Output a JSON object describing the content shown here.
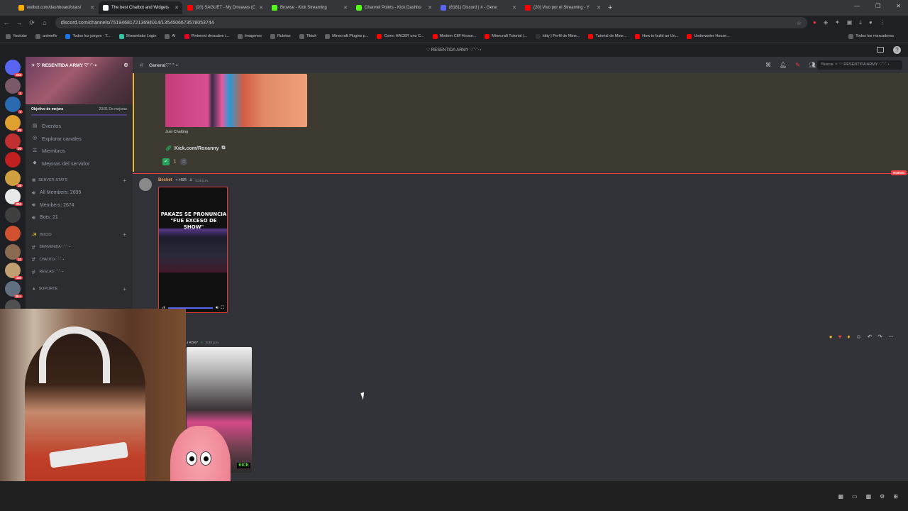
{
  "browser": {
    "tabs": [
      {
        "label": "ixelbot.com/dashboard/stats/",
        "color": "#f9ab00",
        "active": false
      },
      {
        "label": "The best Chatbot and Widgets",
        "color": "#ffffff",
        "active": true
      },
      {
        "label": "(20) SAGUET - My Drreaves (C",
        "color": "#ff0000",
        "active": false
      },
      {
        "label": "Browse - Kick Streaming",
        "color": "#53fc18",
        "active": false
      },
      {
        "label": "Channel Points - Kick Dashbo",
        "color": "#53fc18",
        "active": false
      },
      {
        "label": "(6181) Discord | # - Gene",
        "color": "#5865f2",
        "active": false
      },
      {
        "label": "(20) Vivo por el Streaming - Y",
        "color": "#ff0000",
        "active": false
      }
    ],
    "new_tab": "+",
    "url": "discord.com/channels/751946817213694014/1354506673578053744",
    "bookmarks": [
      {
        "label": "Youtube",
        "color": "#5f6368"
      },
      {
        "label": "animeflv",
        "color": "#5f6368"
      },
      {
        "label": "Todos los juegos - T...",
        "color": "#1a73e8"
      },
      {
        "label": "Streamlabs Login",
        "color": "#31c3a2"
      },
      {
        "label": "AI",
        "color": "#5f6368"
      },
      {
        "label": "Pinterest descubre i...",
        "color": "#e60023"
      },
      {
        "label": "Imagenes",
        "color": "#5f6368"
      },
      {
        "label": "Ruletas",
        "color": "#5f6368"
      },
      {
        "label": "Tiktok",
        "color": "#5f6368"
      },
      {
        "label": "Minecraft Plugins p...",
        "color": "#5f6368"
      },
      {
        "label": "Como HACER uno C...",
        "color": "#ff0000"
      },
      {
        "label": "Modern Cliff House...",
        "color": "#ff0000"
      },
      {
        "label": "Minecraft Tutorial |...",
        "color": "#ff0000"
      },
      {
        "label": "kitty | Perfil de Mine...",
        "color": "#333333"
      },
      {
        "label": "Tutorial de Mine...",
        "color": "#ff0000"
      },
      {
        "label": "How to build an Un...",
        "color": "#ff0000"
      },
      {
        "label": "Underwater House...",
        "color": "#ff0000"
      }
    ],
    "bookmarks_right": "Todos los marcadores"
  },
  "discord": {
    "window_title": "♡ RESENTIDA ARMY ♡˚‧˚‧⋆",
    "server": {
      "name": "✧ ♡ RESENTIDA ARMY ♡˚‧˚‧⋆",
      "boost_label": "Objetivo de mejora",
      "boost_progress": "23/31 De mejoras",
      "nav": [
        {
          "label": "Eventos",
          "icon": "calendar-icon"
        },
        {
          "label": "Explorar canales",
          "icon": "compass-icon"
        },
        {
          "label": "Miembros",
          "icon": "members-icon"
        },
        {
          "label": "Mejoras del servidor",
          "icon": "boost-icon"
        }
      ],
      "stats_category": "SERVER STATS",
      "stats": [
        {
          "label": "All Members: 2695"
        },
        {
          "label": "Members: 2674"
        },
        {
          "label": "Bots: 21"
        }
      ],
      "inicio_category": "INICIO",
      "channels": [
        {
          "label": "BIENVENIDA♡˚‧˚‧⋆"
        },
        {
          "label": "CHATITO♡˚‧˚‧⋆"
        },
        {
          "label": "REGLAS♡˚‧˚‧⋆"
        }
      ],
      "soporte_category": "SOPORTE",
      "server_badges": [
        "204",
        "1",
        "4",
        "85",
        "20",
        "",
        "16",
        "390",
        "",
        "",
        "12",
        "430",
        "2K+",
        ""
      ]
    },
    "channel": {
      "name": "General♡˚‧˚‧⋆",
      "search_placeholder": "Buscar ✧ ♡ RESENTIDA ARMY ♡˚‧˚‧⋆"
    },
    "messages": {
      "embed_category": "Just Chatting",
      "embed_link": "Kick.com/Roxanny",
      "reaction_count": "1",
      "new_label": "NUEVO",
      "msg1_user": "Becket",
      "msg1_tag": "✧ HSR",
      "msg1_time": "8:35 p.m.",
      "video1_title": "PAKAZS SE PRONUNCIA \"FUE EXCESO DE SHOW\"",
      "msg2_user": "J ROXY",
      "msg2_time": "8:40 p.m.",
      "kick_watermark": "KICK"
    }
  }
}
